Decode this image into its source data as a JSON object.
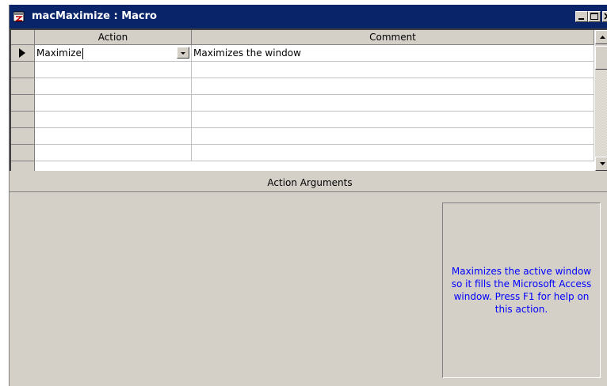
{
  "window": {
    "title": "macMaximize : Macro",
    "icon": "macro-icon",
    "controls": [
      "minimize-icon",
      "maximize-icon",
      "close-icon"
    ]
  },
  "grid": {
    "columns": [
      "Action",
      "Comment"
    ],
    "rows": [
      {
        "action": "Maximize",
        "comment": "Maximizes the window",
        "current": true
      },
      {
        "action": "",
        "comment": ""
      },
      {
        "action": "",
        "comment": ""
      },
      {
        "action": "",
        "comment": ""
      },
      {
        "action": "",
        "comment": ""
      },
      {
        "action": "",
        "comment": ""
      },
      {
        "action": "",
        "comment": ""
      }
    ]
  },
  "arguments": {
    "title": "Action Arguments",
    "help_text": "Maximizes the active window so it fills the Microsoft Access window. Press F1 for help on this action."
  },
  "colors": {
    "titlebar": "#0a246a",
    "face": "#d4d0c8",
    "help_text": "#0000ff"
  }
}
